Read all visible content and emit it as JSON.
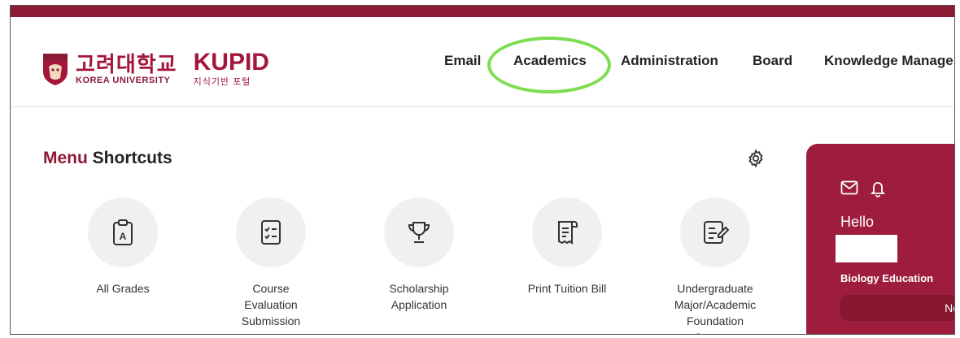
{
  "header": {
    "university_ko": "고려대학교",
    "university_en": "KOREA UNIVERSITY",
    "portal_name": "KUPID",
    "portal_subtitle": "지식기반 포털",
    "nav": [
      "Email",
      "Academics",
      "Administration",
      "Board",
      "Knowledge Manage"
    ],
    "selected_nav": "Academics"
  },
  "shortcuts": {
    "title_accent": "Menu",
    "title_rest": " Shortcuts",
    "items": [
      {
        "label": "All Grades",
        "icon": "clipboard-a-icon"
      },
      {
        "label": "Course\nEvaluation\nSubmission",
        "icon": "checklist-icon"
      },
      {
        "label": "Scholarship\nApplication",
        "icon": "trophy-icon"
      },
      {
        "label": "Print Tuition Bill",
        "icon": "receipt-icon"
      },
      {
        "label": "Undergraduate\nMajor/Academic\nFoundation\nCourses",
        "icon": "document-edit-icon"
      }
    ]
  },
  "profile_card": {
    "greeting": "Hello",
    "department": "Biology Education",
    "button_label": "Ne"
  },
  "colors": {
    "brand": "#8b1a34",
    "card": "#9e1d3e",
    "highlight": "#7ddc4f"
  }
}
